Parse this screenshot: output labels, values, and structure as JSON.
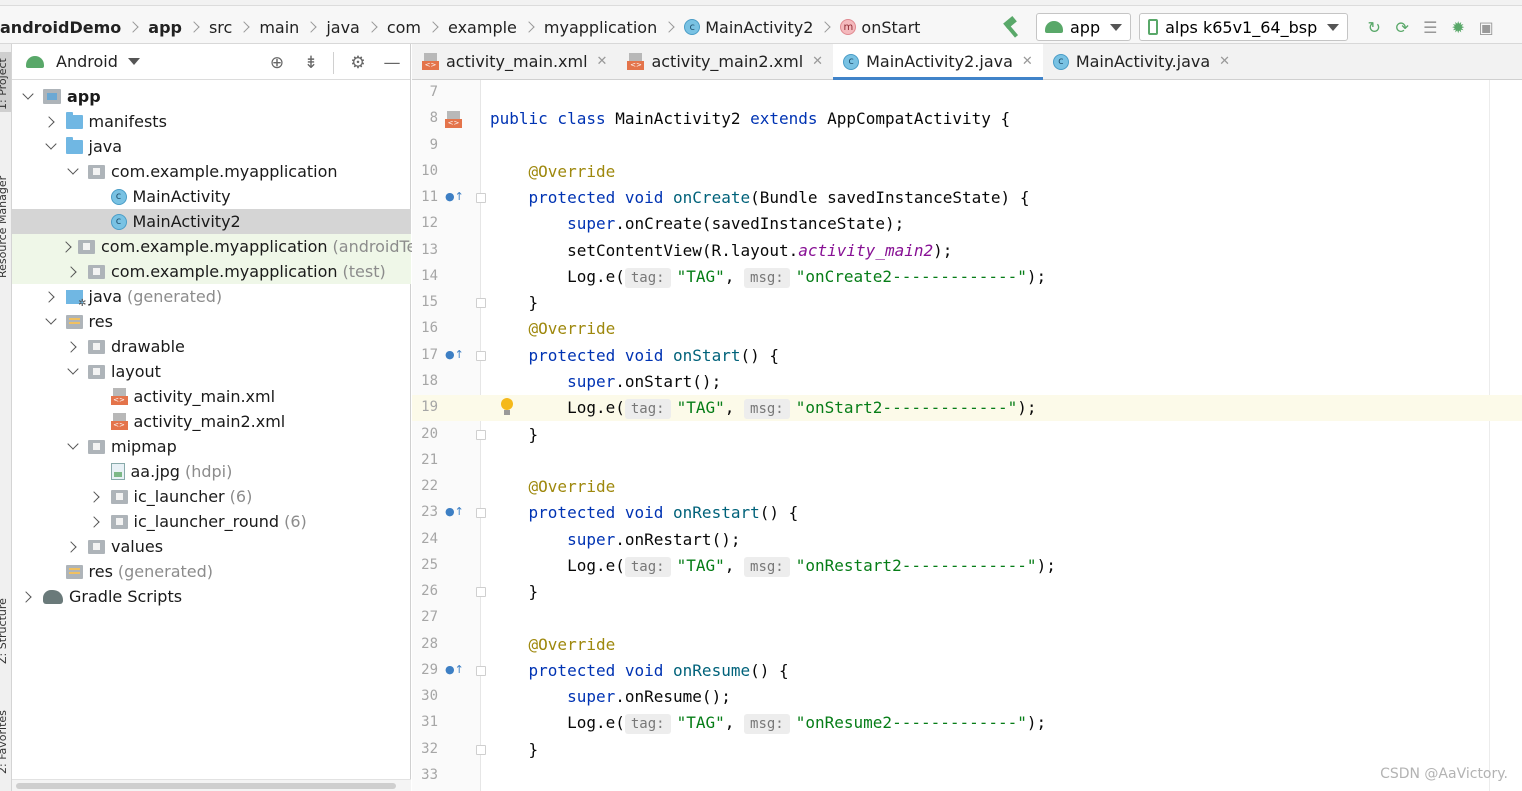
{
  "breadcrumb": {
    "items": [
      {
        "label": "androidDemo",
        "bold": true
      },
      {
        "label": "app",
        "bold": true
      },
      {
        "label": "src"
      },
      {
        "label": "main"
      },
      {
        "label": "java"
      },
      {
        "label": "com"
      },
      {
        "label": "example"
      },
      {
        "label": "myapplication"
      },
      {
        "label": "MainActivity2",
        "icon": "class-icon"
      },
      {
        "label": "onStart",
        "icon": "method-icon"
      }
    ]
  },
  "toolbar": {
    "config_label": "app",
    "device_label": "alps k65v1_64_bsp"
  },
  "side_strip": {
    "project_label": "1: Project",
    "resource_label": "Resource Manager",
    "structure_label": "Z: Structure",
    "favorites_label": "2: Favorites"
  },
  "project_panel": {
    "view_label": "Android",
    "tree": [
      {
        "label": "app",
        "depth": 0,
        "expand": "down",
        "icon": "module",
        "bold": true
      },
      {
        "label": "manifests",
        "depth": 1,
        "expand": "right",
        "icon": "folder-blue"
      },
      {
        "label": "java",
        "depth": 1,
        "expand": "down",
        "icon": "folder-blue"
      },
      {
        "label": "com.example.myapplication",
        "depth": 2,
        "expand": "down",
        "icon": "package"
      },
      {
        "label": "MainActivity",
        "depth": 3,
        "expand": "none",
        "icon": "class"
      },
      {
        "label": "MainActivity2",
        "depth": 3,
        "expand": "none",
        "icon": "class",
        "selected": true
      },
      {
        "label": "com.example.myapplication",
        "suffix": "(androidTest)",
        "depth": 2,
        "expand": "right",
        "icon": "package",
        "green": true
      },
      {
        "label": "com.example.myapplication",
        "suffix": "(test)",
        "depth": 2,
        "expand": "right",
        "icon": "package",
        "green": true
      },
      {
        "label": "java",
        "suffix": "(generated)",
        "depth": 1,
        "expand": "right",
        "icon": "generated"
      },
      {
        "label": "res",
        "depth": 1,
        "expand": "down",
        "icon": "res"
      },
      {
        "label": "drawable",
        "depth": 2,
        "expand": "right",
        "icon": "package"
      },
      {
        "label": "layout",
        "depth": 2,
        "expand": "down",
        "icon": "package"
      },
      {
        "label": "activity_main.xml",
        "depth": 3,
        "expand": "none",
        "icon": "xml"
      },
      {
        "label": "activity_main2.xml",
        "depth": 3,
        "expand": "none",
        "icon": "xml"
      },
      {
        "label": "mipmap",
        "depth": 2,
        "expand": "down",
        "icon": "package"
      },
      {
        "label": "aa.jpg",
        "suffix": "(hdpi)",
        "depth": 3,
        "expand": "none",
        "icon": "image"
      },
      {
        "label": "ic_launcher",
        "suffix": "(6)",
        "depth": 3,
        "expand": "right",
        "icon": "package"
      },
      {
        "label": "ic_launcher_round",
        "suffix": "(6)",
        "depth": 3,
        "expand": "right",
        "icon": "package"
      },
      {
        "label": "values",
        "depth": 2,
        "expand": "right",
        "icon": "package"
      },
      {
        "label": "res",
        "suffix": "(generated)",
        "depth": 1,
        "expand": "none",
        "icon": "res"
      },
      {
        "label": "Gradle Scripts",
        "depth": 0,
        "expand": "right",
        "icon": "gradle"
      }
    ]
  },
  "editor": {
    "tabs": [
      {
        "label": "activity_main.xml",
        "icon": "xml"
      },
      {
        "label": "activity_main2.xml",
        "icon": "xml"
      },
      {
        "label": "MainActivity2.java",
        "icon": "class",
        "active": true
      },
      {
        "label": "MainActivity.java",
        "icon": "class"
      }
    ],
    "current_line": 19,
    "lines": [
      {
        "n": 7,
        "tokens": []
      },
      {
        "n": 8,
        "tokens": [
          [
            "kw",
            "public class "
          ],
          [
            "t",
            "MainActivity2 "
          ],
          [
            "kw",
            "extends "
          ],
          [
            "t",
            "AppCompatActivity {"
          ]
        ],
        "marker": "xml"
      },
      {
        "n": 9,
        "tokens": []
      },
      {
        "n": 10,
        "tokens": [
          [
            "t",
            "    "
          ],
          [
            "ann",
            "@Override"
          ]
        ]
      },
      {
        "n": 11,
        "tokens": [
          [
            "t",
            "    "
          ],
          [
            "kw",
            "protected void "
          ],
          [
            "mth",
            "onCreate"
          ],
          [
            "t",
            "(Bundle savedInstanceState) {"
          ]
        ],
        "marker": "override",
        "fold": true
      },
      {
        "n": 12,
        "tokens": [
          [
            "t",
            "        "
          ],
          [
            "kw",
            "super"
          ],
          [
            "t",
            ".onCreate(savedInstanceState);"
          ]
        ]
      },
      {
        "n": 13,
        "tokens": [
          [
            "t",
            "        setContentView(R.layout."
          ],
          [
            "fld",
            "activity_main2"
          ],
          [
            "t",
            ");"
          ]
        ]
      },
      {
        "n": 14,
        "tokens": [
          [
            "t",
            "        Log."
          ],
          [
            "t",
            "e("
          ],
          [
            "hint",
            "tag:"
          ],
          [
            "str",
            "\"TAG\""
          ],
          [
            "t",
            ", "
          ],
          [
            "hint",
            "msg:"
          ],
          [
            "str",
            "\"onCreate2-------------\""
          ],
          [
            "t",
            ");"
          ]
        ]
      },
      {
        "n": 15,
        "tokens": [
          [
            "t",
            "    }"
          ]
        ],
        "fold": true
      },
      {
        "n": 16,
        "tokens": [
          [
            "t",
            "    "
          ],
          [
            "ann",
            "@Override"
          ]
        ]
      },
      {
        "n": 17,
        "tokens": [
          [
            "t",
            "    "
          ],
          [
            "kw",
            "protected void "
          ],
          [
            "mth",
            "onStart"
          ],
          [
            "t",
            "() {"
          ]
        ],
        "marker": "override",
        "fold": true
      },
      {
        "n": 18,
        "tokens": [
          [
            "t",
            "        "
          ],
          [
            "kw",
            "super"
          ],
          [
            "t",
            ".onStart();"
          ]
        ]
      },
      {
        "n": 19,
        "tokens": [
          [
            "t",
            "        Log."
          ],
          [
            "t",
            "e("
          ],
          [
            "hint",
            "tag:"
          ],
          [
            "str",
            "\"TAG\""
          ],
          [
            "t",
            ", "
          ],
          [
            "hint",
            "msg:"
          ],
          [
            "str",
            "\"onStart2-------------\""
          ],
          [
            "t",
            ");"
          ]
        ],
        "bulb": true
      },
      {
        "n": 20,
        "tokens": [
          [
            "t",
            "    }"
          ]
        ],
        "fold": true
      },
      {
        "n": 21,
        "tokens": []
      },
      {
        "n": 22,
        "tokens": [
          [
            "t",
            "    "
          ],
          [
            "ann",
            "@Override"
          ]
        ]
      },
      {
        "n": 23,
        "tokens": [
          [
            "t",
            "    "
          ],
          [
            "kw",
            "protected void "
          ],
          [
            "mth",
            "onRestart"
          ],
          [
            "t",
            "() {"
          ]
        ],
        "marker": "override",
        "fold": true
      },
      {
        "n": 24,
        "tokens": [
          [
            "t",
            "        "
          ],
          [
            "kw",
            "super"
          ],
          [
            "t",
            ".onRestart();"
          ]
        ]
      },
      {
        "n": 25,
        "tokens": [
          [
            "t",
            "        Log."
          ],
          [
            "t",
            "e("
          ],
          [
            "hint",
            "tag:"
          ],
          [
            "str",
            "\"TAG\""
          ],
          [
            "t",
            ", "
          ],
          [
            "hint",
            "msg:"
          ],
          [
            "str",
            "\"onRestart2-------------\""
          ],
          [
            "t",
            ");"
          ]
        ]
      },
      {
        "n": 26,
        "tokens": [
          [
            "t",
            "    }"
          ]
        ],
        "fold": true
      },
      {
        "n": 27,
        "tokens": []
      },
      {
        "n": 28,
        "tokens": [
          [
            "t",
            "    "
          ],
          [
            "ann",
            "@Override"
          ]
        ]
      },
      {
        "n": 29,
        "tokens": [
          [
            "t",
            "    "
          ],
          [
            "kw",
            "protected void "
          ],
          [
            "mth",
            "onResume"
          ],
          [
            "t",
            "() {"
          ]
        ],
        "marker": "override",
        "fold": true
      },
      {
        "n": 30,
        "tokens": [
          [
            "t",
            "        "
          ],
          [
            "kw",
            "super"
          ],
          [
            "t",
            ".onResume();"
          ]
        ]
      },
      {
        "n": 31,
        "tokens": [
          [
            "t",
            "        Log."
          ],
          [
            "t",
            "e("
          ],
          [
            "hint",
            "tag:"
          ],
          [
            "str",
            "\"TAG\""
          ],
          [
            "t",
            ", "
          ],
          [
            "hint",
            "msg:"
          ],
          [
            "str",
            "\"onResume2-------------\""
          ],
          [
            "t",
            ");"
          ]
        ]
      },
      {
        "n": 32,
        "tokens": [
          [
            "t",
            "    }"
          ]
        ],
        "fold": true
      },
      {
        "n": 33,
        "tokens": []
      }
    ]
  },
  "watermark": "CSDN @AaVictory."
}
